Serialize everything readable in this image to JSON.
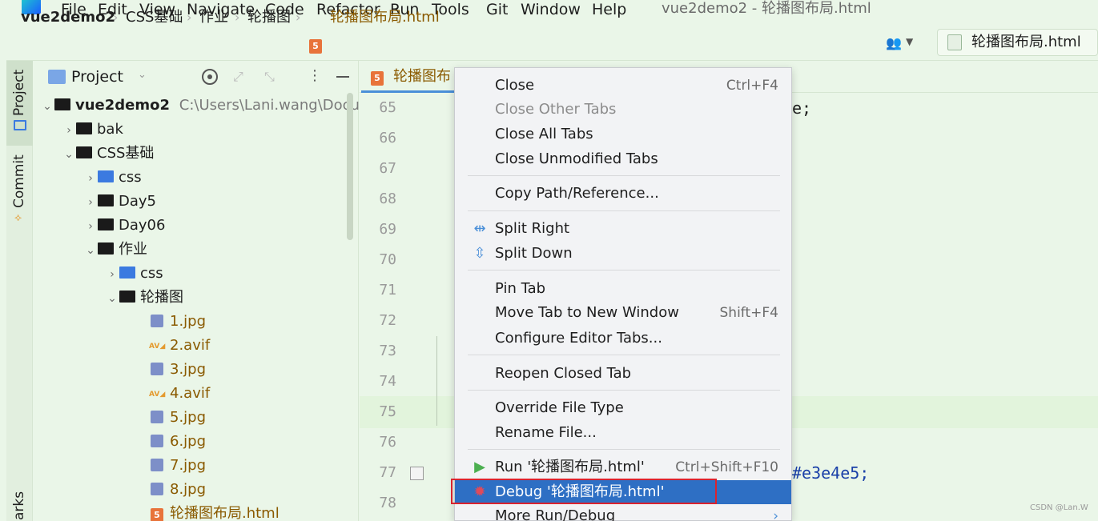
{
  "window": {
    "title": "vue2demo2 - 轮播图布局.html"
  },
  "menubar": {
    "items": [
      "File",
      "Edit",
      "View",
      "Navigate",
      "Code",
      "Refactor",
      "Run",
      "Tools",
      "Git",
      "Window",
      "Help"
    ]
  },
  "breadcrumb": {
    "items": [
      "vue2demo2",
      "CSS基础",
      "作业",
      "轮播图",
      "轮播图布局.html"
    ]
  },
  "run_config": {
    "label": "轮播图布局.html"
  },
  "tool_strip": {
    "project_tab": "Project",
    "commit_tab": "Commit",
    "bookmarks_tab": "arks"
  },
  "project_panel": {
    "title": "Project",
    "tree": [
      {
        "label": "vue2demo2",
        "path": "C:\\Users\\Lani.wang\\Docum",
        "level": 0,
        "type": "folder",
        "expanded": true
      },
      {
        "label": "bak",
        "level": 1,
        "type": "folder",
        "expanded": false
      },
      {
        "label": "CSS基础",
        "level": 1,
        "type": "folder",
        "expanded": true
      },
      {
        "label": "css",
        "level": 2,
        "type": "folder-blue",
        "expanded": false
      },
      {
        "label": "Day5",
        "level": 2,
        "type": "folder",
        "expanded": false
      },
      {
        "label": "Day06",
        "level": 2,
        "type": "folder",
        "expanded": false
      },
      {
        "label": "作业",
        "level": 2,
        "type": "folder",
        "expanded": true
      },
      {
        "label": "css",
        "level": 3,
        "type": "folder-blue",
        "expanded": false
      },
      {
        "label": "轮播图",
        "level": 3,
        "type": "folder",
        "expanded": true
      },
      {
        "label": "1.jpg",
        "level": 4,
        "type": "image"
      },
      {
        "label": "2.avif",
        "level": 4,
        "type": "avif"
      },
      {
        "label": "3.jpg",
        "level": 4,
        "type": "image"
      },
      {
        "label": "4.avif",
        "level": 4,
        "type": "avif"
      },
      {
        "label": "5.jpg",
        "level": 4,
        "type": "image"
      },
      {
        "label": "6.jpg",
        "level": 4,
        "type": "image"
      },
      {
        "label": "7.jpg",
        "level": 4,
        "type": "image"
      },
      {
        "label": "8.jpg",
        "level": 4,
        "type": "image"
      },
      {
        "label": "轮播图布局.html",
        "level": 4,
        "type": "html"
      }
    ]
  },
  "editor": {
    "tab_label": "轮播图布",
    "line_numbers": [
      "65",
      "66",
      "67",
      "68",
      "69",
      "70",
      "71",
      "72",
      "73",
      "74",
      "75",
      "76",
      "77",
      "78"
    ],
    "code_fragments": {
      "line65": "e;",
      "line77": "#e3e4e5;"
    }
  },
  "context_menu": {
    "close": {
      "label": "Close",
      "shortcut": "Ctrl+F4"
    },
    "close_other": {
      "label": "Close Other Tabs"
    },
    "close_all": {
      "label": "Close All Tabs"
    },
    "close_unmodified": {
      "label": "Close Unmodified Tabs"
    },
    "copy_path": {
      "label": "Copy Path/Reference..."
    },
    "split_right": {
      "label": "Split Right"
    },
    "split_down": {
      "label": "Split Down"
    },
    "pin_tab": {
      "label": "Pin Tab"
    },
    "move_tab": {
      "label": "Move Tab to New Window",
      "shortcut": "Shift+F4"
    },
    "configure_tabs": {
      "label": "Configure Editor Tabs..."
    },
    "reopen_closed": {
      "label": "Reopen Closed Tab"
    },
    "override_type": {
      "label": "Override File Type"
    },
    "rename_file": {
      "label": "Rename File..."
    },
    "run": {
      "label": "Run '轮播图布局.html'",
      "shortcut": "Ctrl+Shift+F10"
    },
    "debug": {
      "label": "Debug '轮播图布局.html'"
    },
    "more_run": {
      "label": "More Run/Debug"
    }
  },
  "watermark": "CSDN @Lan.W",
  "colors": {
    "background": "#eaf6e8",
    "menu_bg": "#f2f3f5",
    "selection": "#2e6fc4",
    "outline_red": "#d9232f",
    "html_icon": "#e8733a",
    "run_green": "#4caf50",
    "debug_red": "#e04a5a"
  }
}
